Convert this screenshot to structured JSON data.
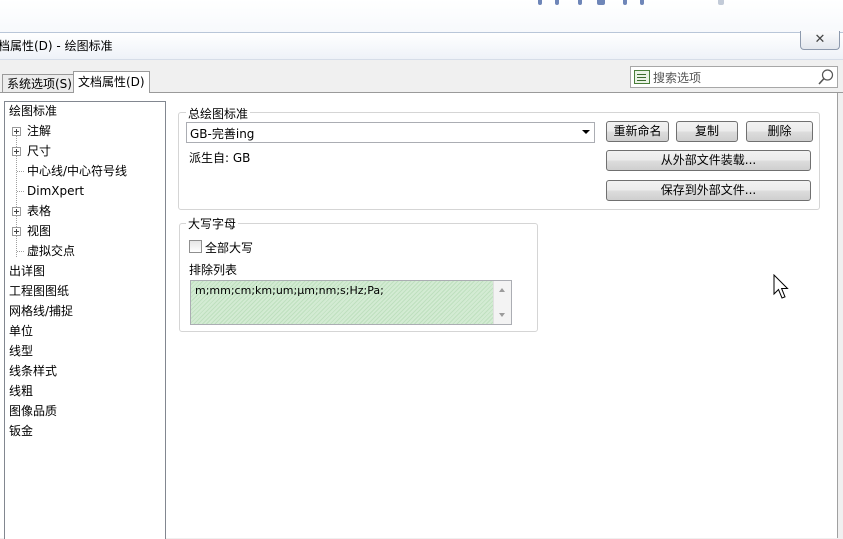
{
  "window": {
    "title": "档属性(D) - 绘图标准",
    "close_glyph": "✕"
  },
  "tabs": [
    {
      "label": "系统选项(S)",
      "active": false
    },
    {
      "label": "文档属性(D)",
      "active": true
    }
  ],
  "search": {
    "placeholder": "搜索选项",
    "icon": "search-icon"
  },
  "tree": {
    "items": [
      {
        "label": "绘图标准",
        "selected": true
      },
      {
        "label": "注解",
        "expandable": true
      },
      {
        "label": "尺寸",
        "expandable": true
      },
      {
        "label": "中心线/中心符号线"
      },
      {
        "label": "DimXpert"
      },
      {
        "label": "表格",
        "expandable": true
      },
      {
        "label": "视图",
        "expandable": true
      },
      {
        "label": "虚拟交点"
      },
      {
        "label": "出详图"
      },
      {
        "label": "工程图图纸"
      },
      {
        "label": "网格线/捕捉"
      },
      {
        "label": "单位"
      },
      {
        "label": "线型"
      },
      {
        "label": "线条样式"
      },
      {
        "label": "线粗"
      },
      {
        "label": "图像品质"
      },
      {
        "label": "钣金"
      }
    ]
  },
  "overall_standard": {
    "group_label": "总绘图标准",
    "selected_value": "GB-完善ing",
    "derived_from": "派生自: GB",
    "buttons": {
      "rename": "重新命名",
      "copy": "复制",
      "delete": "删除",
      "load_external": "从外部文件装载...",
      "save_external": "保存到外部文件..."
    }
  },
  "uppercase": {
    "group_label": "大写字母",
    "all_caps_label": "全部大写",
    "all_caps_checked": false,
    "exclusion_label": "排除列表",
    "exclusion_value": "m;mm;cm;km;um;µm;nm;s;Hz;Pa;"
  }
}
